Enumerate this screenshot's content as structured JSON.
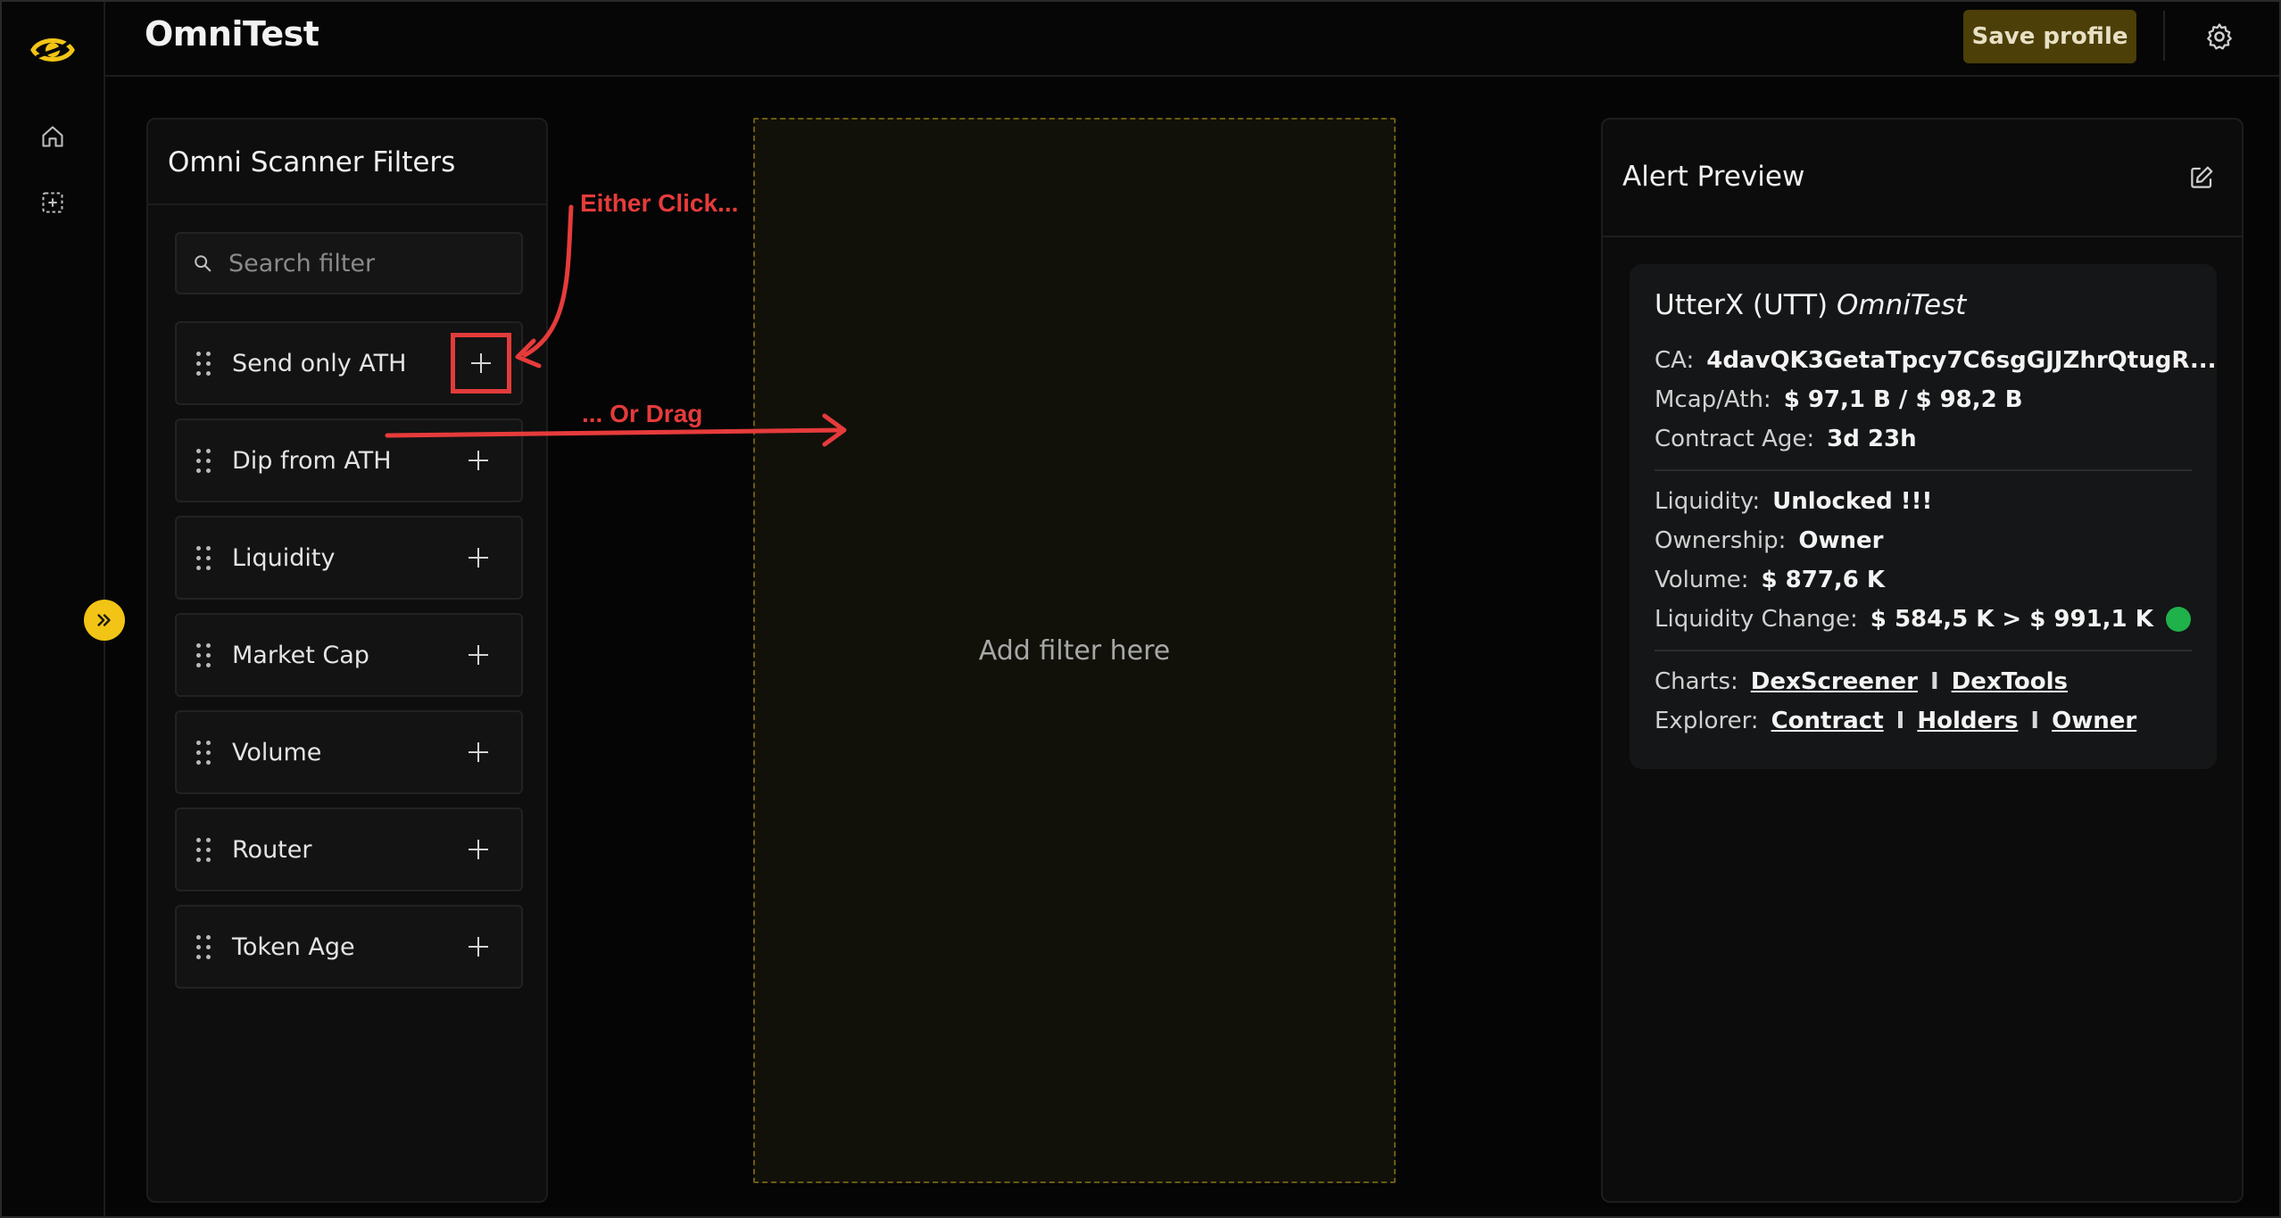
{
  "app": {
    "title": "OmniTest"
  },
  "topbar": {
    "save_label": "Save profile"
  },
  "filters": {
    "title": "Omni Scanner Filters",
    "search_placeholder": "Search filter",
    "items": [
      {
        "label": "Send only ATH"
      },
      {
        "label": "Dip from ATH"
      },
      {
        "label": "Liquidity"
      },
      {
        "label": "Market Cap"
      },
      {
        "label": "Volume"
      },
      {
        "label": "Router"
      },
      {
        "label": "Token Age"
      }
    ]
  },
  "dropzone": {
    "text": "Add filter here"
  },
  "alert": {
    "title": "Alert Preview",
    "token_name": "UtterX (UTT)",
    "token_source": "OmniTest",
    "ca_label": "CA:",
    "ca_value": "4davQK3GetaTpcy7C6sgGJJZhrQtugR...",
    "mcap_label": "Mcap/Ath:",
    "mcap_value": "$ 97,1 B / $ 98,2 B",
    "age_label": "Contract Age:",
    "age_value": "3d 23h",
    "liquidity_label": "Liquidity:",
    "liquidity_value": "Unlocked !!!",
    "ownership_label": "Ownership:",
    "ownership_value": "Owner",
    "volume_label": "Volume:",
    "volume_value": "$ 877,6 K",
    "liqchange_label": "Liquidity Change:",
    "liqchange_value": "$ 584,5 K > $ 991,1 K",
    "charts_label": "Charts:",
    "charts_links": [
      "DexScreener",
      "DexTools"
    ],
    "explorer_label": "Explorer:",
    "explorer_links": [
      "Contract",
      "Holders",
      "Owner"
    ],
    "link_separator": "I"
  },
  "annotations": {
    "click_text": "Either Click...",
    "drag_text": "... Or Drag"
  },
  "colors": {
    "accent": "#f2c415",
    "save_button_bg": "#4c3f08",
    "annotation": "#e63b3b",
    "status_green": "#1fb14a"
  },
  "icons": [
    "eye-logo-icon",
    "home-icon",
    "scan-icon",
    "chevrons-right-icon",
    "gear-icon",
    "search-icon",
    "drag-handle-icon",
    "plus-icon",
    "edit-icon",
    "copy-icon"
  ]
}
